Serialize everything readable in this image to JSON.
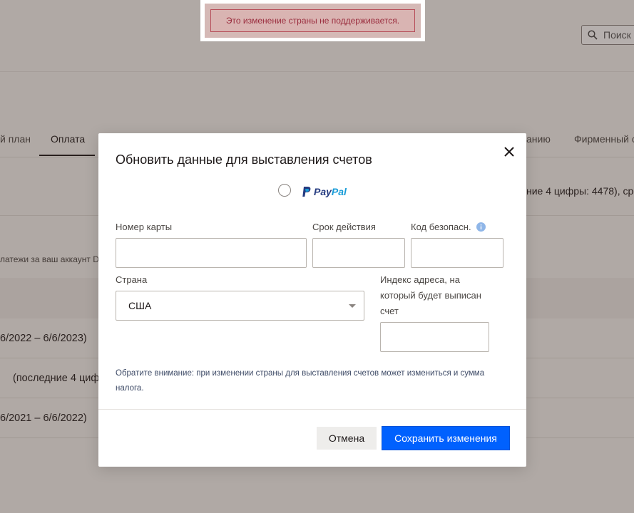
{
  "error_banner": {
    "message": "Это изменение страны не поддерживается."
  },
  "background": {
    "search_placeholder": "Поиск",
    "tabs": [
      "й план",
      "Оплата",
      "анию",
      "Фирменный с"
    ],
    "card_info_partial": "ние 4 цифры: 4478), сро",
    "payments_text_partial": "латежи за ваш аккаунт D",
    "period_1": "6/2022 – 6/6/2023)",
    "card_last4_partial": "(последние 4 циф",
    "period_2": "6/2021 – 6/6/2022)"
  },
  "modal": {
    "title": "Обновить данные для выставления счетов",
    "paypal": {
      "part1": "Pay",
      "part2": "Pal"
    },
    "card_number_label": "Номер карты",
    "expiry_label": "Срок действия",
    "cvc_label": "Код безопасн.",
    "country_label": "Страна",
    "country_value": "США",
    "zip_label": "Индекс адреса, на который будет выписан счет",
    "note": "Обратите внимание: при изменении страны для выставления счетов может измениться и сумма налога.",
    "cancel_label": "Отмена",
    "save_label": "Сохранить изменения"
  },
  "colors": {
    "primary_button": "#0061fe",
    "error_text": "#9a2c3d",
    "paypal_dark": "#253b80",
    "paypal_light": "#179bd7"
  }
}
